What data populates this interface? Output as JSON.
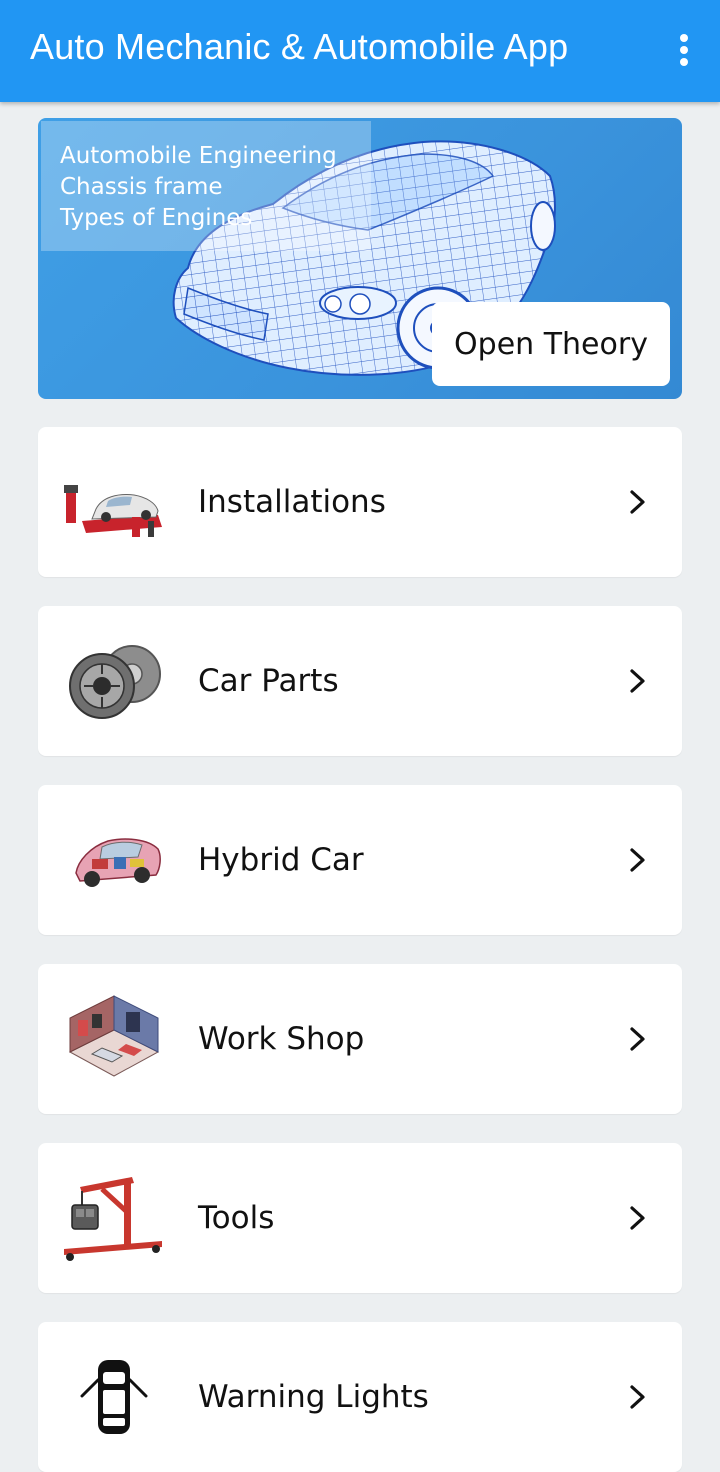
{
  "app_bar": {
    "title": "Auto Mechanic & Automobile App",
    "menu_icon": "more-vert-icon",
    "color": "#2196F3"
  },
  "banner": {
    "topics": [
      "Automobile Engineering",
      "Chassis frame",
      "Types of Engines"
    ],
    "button_label": "Open Theory",
    "image": "wireframe-car"
  },
  "menu": [
    {
      "label": "Installations",
      "icon": "car-lift-icon"
    },
    {
      "label": "Car Parts",
      "icon": "clutch-plate-icon"
    },
    {
      "label": "Hybrid Car",
      "icon": "hybrid-car-icon"
    },
    {
      "label": "Work Shop",
      "icon": "workshop-icon"
    },
    {
      "label": "Tools",
      "icon": "engine-crane-icon"
    },
    {
      "label": "Warning Lights",
      "icon": "car-top-view-icon"
    }
  ],
  "colors": {
    "background": "#ECEFF1",
    "card": "#FFFFFF",
    "banner": "#3A93DC"
  }
}
